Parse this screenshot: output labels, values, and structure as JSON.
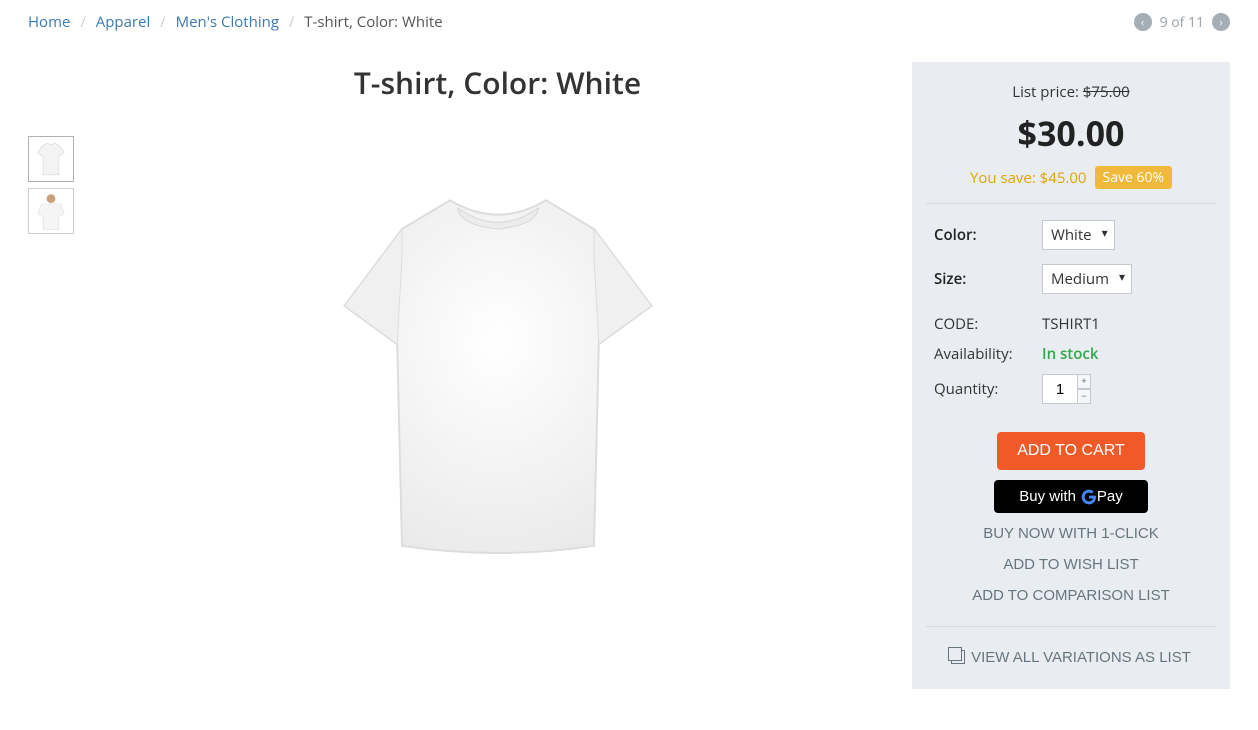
{
  "breadcrumb": {
    "items": [
      {
        "label": "Home"
      },
      {
        "label": "Apparel"
      },
      {
        "label": "Men's Clothing"
      }
    ],
    "current": "T-shirt, Color: White"
  },
  "pager": {
    "position": "9",
    "total": "11"
  },
  "product": {
    "title": "T-shirt, Color: White",
    "list_price_label": "List price:",
    "list_price": "$75.00",
    "price": "$30.00",
    "you_save_label": "You save: $45.00",
    "save_badge": "Save 60%",
    "options": {
      "color_label": "Color:",
      "color_value": "White",
      "size_label": "Size:",
      "size_value": "Medium"
    },
    "code_label": "CODE:",
    "code": "TSHIRT1",
    "availability_label": "Availability:",
    "availability": "In stock",
    "quantity_label": "Quantity:",
    "quantity": "1",
    "actions": {
      "add_to_cart": "ADD TO CART",
      "gpay_prefix": "Buy with",
      "buy_now": "BUY NOW WITH 1-CLICK",
      "wishlist": "ADD TO WISH LIST",
      "compare": "ADD TO COMPARISON LIST",
      "view_variations": "VIEW ALL VARIATIONS AS LIST"
    }
  },
  "gpay": {
    "pay_text": "Pay"
  }
}
